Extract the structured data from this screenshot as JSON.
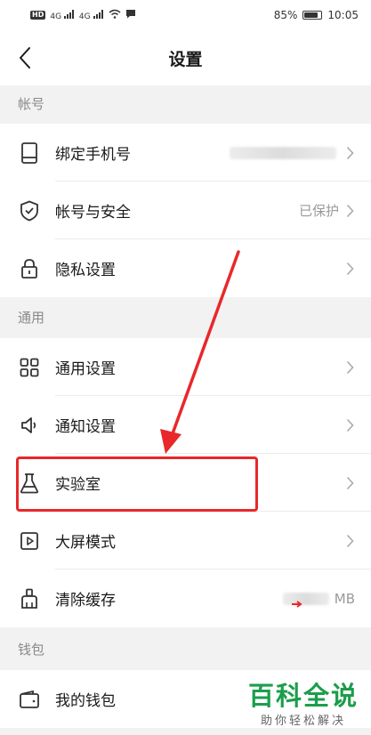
{
  "status_bar": {
    "hd_badge": "HD",
    "network_1": "4G",
    "network_2": "4G",
    "battery_percent": "85%",
    "battery_level": 0.85,
    "time": "10:05"
  },
  "nav": {
    "title": "设置"
  },
  "sections": {
    "account": "帐号",
    "general": "通用",
    "wallet": "钱包"
  },
  "rows": {
    "bind_phone": {
      "label": "绑定手机号",
      "icon": "phone-icon"
    },
    "account_security": {
      "label": "帐号与安全",
      "value": "已保护",
      "icon": "shield-icon"
    },
    "privacy": {
      "label": "隐私设置",
      "icon": "lock-icon"
    },
    "general_settings": {
      "label": "通用设置",
      "icon": "grid-icon"
    },
    "notification": {
      "label": "通知设置",
      "icon": "speaker-icon"
    },
    "lab": {
      "label": "实验室",
      "icon": "flask-icon"
    },
    "big_screen": {
      "label": "大屏模式",
      "icon": "play-square-icon"
    },
    "clear_cache": {
      "label": "清除缓存",
      "value_suffix": "MB",
      "icon": "broom-icon"
    },
    "my_wallet": {
      "label": "我的钱包",
      "icon": "wallet-icon"
    }
  },
  "watermark": {
    "title": "百科全说",
    "subtitle": "助你轻松解决"
  },
  "colors": {
    "highlight": "#e8282b",
    "watermark_green": "#1b9e4b"
  }
}
